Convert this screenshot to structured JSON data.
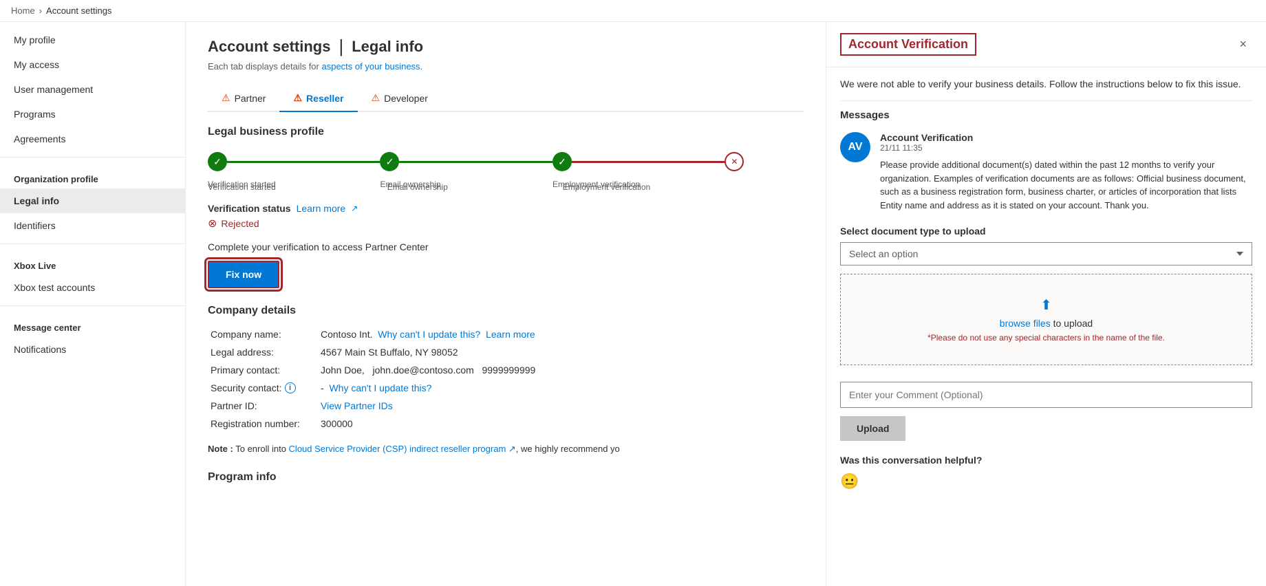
{
  "breadcrumb": {
    "home": "Home",
    "current": "Account settings"
  },
  "sidebar": {
    "items": [
      {
        "id": "my-profile",
        "label": "My profile",
        "active": false
      },
      {
        "id": "my-access",
        "label": "My access",
        "active": false
      },
      {
        "id": "user-management",
        "label": "User management",
        "active": false
      },
      {
        "id": "programs",
        "label": "Programs",
        "active": false
      },
      {
        "id": "agreements",
        "label": "Agreements",
        "active": false
      }
    ],
    "sections": [
      {
        "label": "Organization profile",
        "items": [
          {
            "id": "legal-info",
            "label": "Legal info",
            "active": true
          },
          {
            "id": "identifiers",
            "label": "Identifiers",
            "active": false
          }
        ]
      },
      {
        "label": "Xbox Live",
        "items": [
          {
            "id": "xbox-test-accounts",
            "label": "Xbox test accounts",
            "active": false
          }
        ]
      },
      {
        "label": "Message center",
        "items": [
          {
            "id": "notifications",
            "label": "Notifications",
            "active": false
          }
        ]
      }
    ]
  },
  "main": {
    "page_title": "Account settings",
    "page_title_section": "Legal info",
    "page_subtitle": "Each tab displays details for aspects of your business.",
    "tabs": [
      {
        "id": "partner",
        "label": "Partner",
        "warning": true,
        "active": false
      },
      {
        "id": "reseller",
        "label": "Reseller",
        "warning": true,
        "active": true
      },
      {
        "id": "developer",
        "label": "Developer",
        "warning": true,
        "active": false
      }
    ],
    "legal_profile_title": "Legal business profile",
    "progress_steps": [
      {
        "id": "verification-started",
        "label": "Verification started",
        "state": "done"
      },
      {
        "id": "email-ownership",
        "label": "Email ownership",
        "state": "done"
      },
      {
        "id": "employment-verification",
        "label": "Employment verification",
        "state": "done"
      },
      {
        "id": "final",
        "label": "",
        "state": "error"
      }
    ],
    "verification_status_label": "Verification status",
    "learn_more_label": "Learn more",
    "rejected_label": "Rejected",
    "complete_verification_text": "Complete your verification to access Partner Center",
    "fix_now_label": "Fix now",
    "company_details_title": "Company details",
    "company_fields": [
      {
        "label": "Company name:",
        "value": "Contoso Int.",
        "link1": "Why can't I update this?",
        "link2": "Learn more"
      },
      {
        "label": "Legal address:",
        "value": "4567 Main St Buffalo, NY 98052"
      },
      {
        "label": "Primary contact:",
        "value": "John Doe,",
        "extra": "john.doe@contoso.com",
        "phone": "9999999999"
      },
      {
        "label": "Security contact:",
        "value": "-",
        "link1": "Why can't I update this?",
        "has_info": true
      },
      {
        "label": "Partner ID:",
        "link1": "View Partner IDs"
      },
      {
        "label": "Registration number:",
        "value": "300000"
      }
    ],
    "note_text": "Note : To enroll into ",
    "note_link": "Cloud Service Provider (CSP) indirect reseller program",
    "note_end": ", we highly recommend yo",
    "program_info_title": "Program info"
  },
  "panel": {
    "title": "Account Verification",
    "close_label": "×",
    "intro_text": "We were not able to verify your business details. Follow the instructions below to fix this issue.",
    "messages_label": "Messages",
    "message": {
      "avatar_initials": "AV",
      "sender": "Account Verification",
      "time": "21/11 11:35",
      "body": "Please provide additional document(s) dated within the past 12 months to verify your organization. Examples of verification documents are as follows: Official business document, such as a business registration form, business charter, or articles of incorporation that lists Entity name and address as it is stated on your account. Thank you."
    },
    "select_doc_label": "Select document type to upload",
    "select_placeholder": "Select an option",
    "upload_icon": "⬆",
    "upload_text_before": "browse files",
    "upload_text_after": " to upload",
    "upload_warning": "*Please do not use any special characters in the name of the file.",
    "comment_placeholder": "Enter your Comment (Optional)",
    "upload_button_label": "Upload",
    "helpful_label": "Was this conversation helpful?",
    "helpful_icons": [
      "😐"
    ]
  }
}
